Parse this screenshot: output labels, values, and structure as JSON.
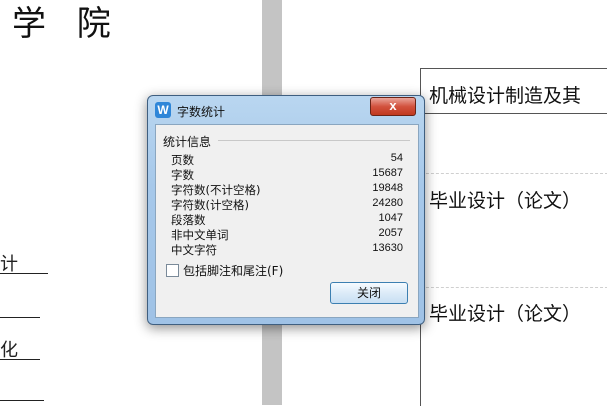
{
  "document": {
    "heading": "学 院",
    "left_fragments": [
      "计",
      "化"
    ],
    "right_lines": [
      "机械设计制造及其",
      "毕业设计（论文）",
      "毕业设计（论文）"
    ]
  },
  "dialog": {
    "title": "字数统计",
    "app_icon_letter": "W",
    "close_glyph": "x",
    "group_title": "统计信息",
    "stats": [
      {
        "label": "页数",
        "value": "54"
      },
      {
        "label": "字数",
        "value": "15687"
      },
      {
        "label": "字符数(不计空格)",
        "value": "19848"
      },
      {
        "label": "字符数(计空格)",
        "value": "24280"
      },
      {
        "label": "段落数",
        "value": "1047"
      },
      {
        "label": "非中文单词",
        "value": "2057"
      },
      {
        "label": "中文字符",
        "value": "13630"
      }
    ],
    "checkbox_label": "包括脚注和尾注(F)",
    "checkbox_checked": false,
    "close_button_label": "关闭"
  },
  "colors": {
    "dialog_frame": "#a6c8ea",
    "close_button": "#c0391f",
    "gutter": "#c4c4c4"
  }
}
